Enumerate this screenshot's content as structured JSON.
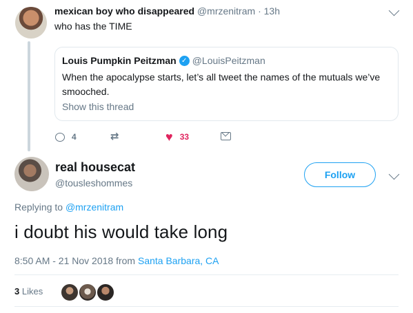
{
  "top_tweet": {
    "display_name": "mexican boy who disappeared",
    "handle": "@mrzenitram",
    "time_sep": "·",
    "time": "13h",
    "text": "who has the TIME"
  },
  "quote": {
    "display_name": "Louis Pumpkin Peitzman",
    "verified_mark": "✓",
    "handle": "@LouisPeitzman",
    "text": "When the apocalypse starts, let’s all tweet the names of the mutuals we’ve smooched.",
    "show_thread": "Show this thread"
  },
  "actions": {
    "reply_count": "4",
    "like_count": "33"
  },
  "reply": {
    "display_name": "real housecat",
    "handle": "@tousleshommes",
    "follow_label": "Follow",
    "replying_to_prefix": "Replying to",
    "replying_to_handle": "@mrzenitram",
    "text": "i doubt his would take long",
    "timestamp": "8:50 AM - 21 Nov 2018 from",
    "location": "Santa Barbara, CA",
    "likes_count": "3",
    "likes_label": "Likes"
  },
  "colors": {
    "link": "#1da1f2",
    "like": "#e0245e",
    "secondary_text": "#657786"
  },
  "icons": [
    "reply-icon",
    "retweet-icon",
    "heart-icon",
    "message-icon",
    "verified-icon",
    "chevron-down-icon"
  ]
}
